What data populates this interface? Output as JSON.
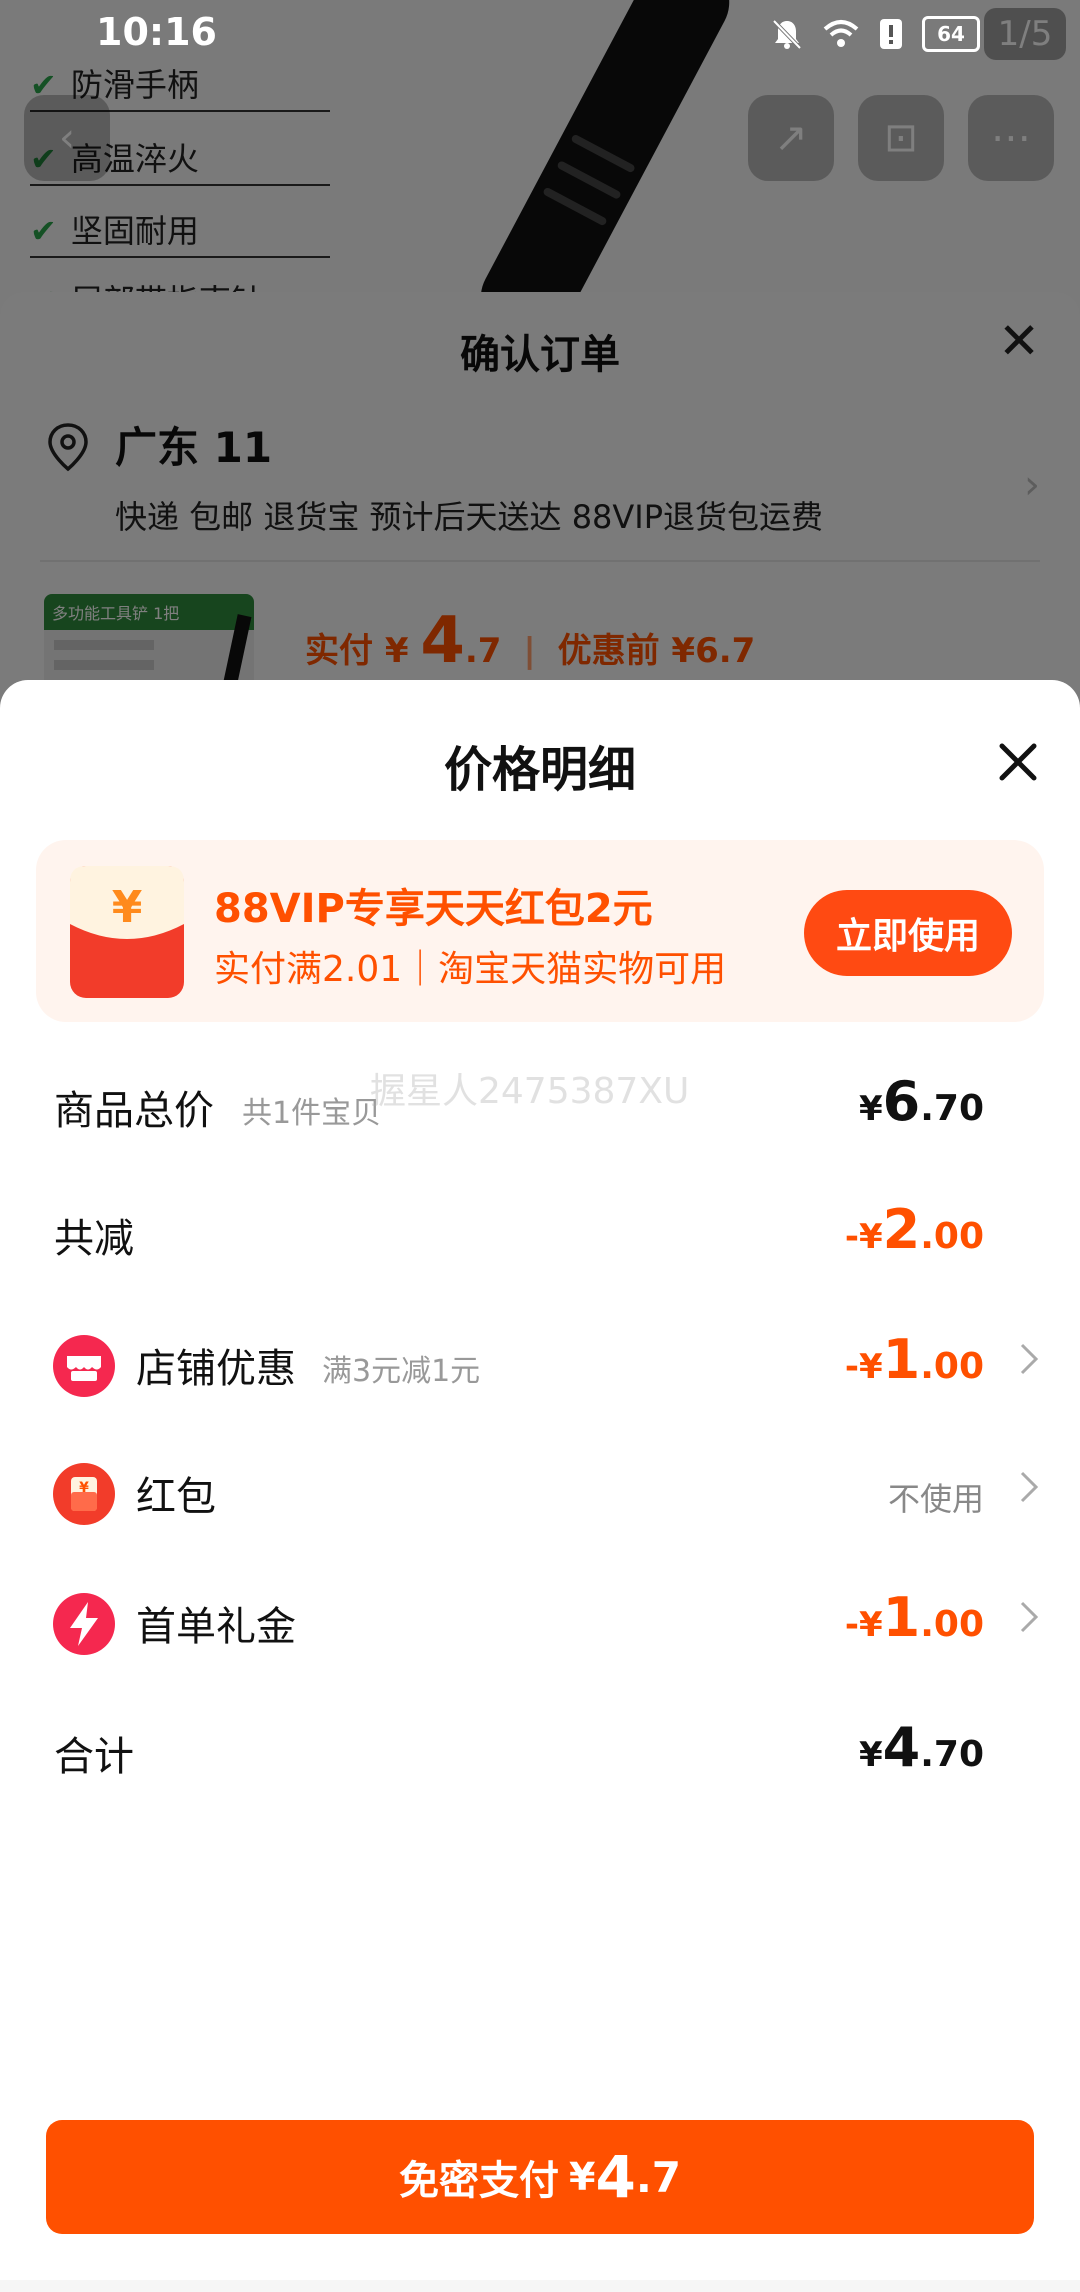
{
  "status_bar": {
    "time": "10:16",
    "battery": "64"
  },
  "background": {
    "features": [
      "防滑手柄",
      "高温淬火",
      "坚固耐用",
      "尾部带指南针"
    ],
    "page_indicator": "1/5",
    "confirm_order": {
      "title": "确认订单",
      "address_name": "广东 11",
      "delivery": "快递 包邮 退货宝 预计后天送达 88VIP退货包运费",
      "thumbnail_caption": "多功能工具铲",
      "thumbnail_badge": "1把",
      "paid_label": "实付",
      "paid_yen": "¥",
      "paid_int": "4",
      "paid_dec": ".7",
      "before_discount": "优惠前 ¥6.7"
    }
  },
  "price_detail": {
    "title": "价格明细",
    "promo": {
      "title": "88VIP专享天天红包2元",
      "subtitle": "实付满2.01｜淘宝天猫实物可用",
      "button": "立即使用"
    },
    "rows": [
      {
        "label": "商品总价",
        "note": "共1件宝贝",
        "sign": "¥",
        "int": "6",
        "dec": ".70"
      },
      {
        "label": "共减",
        "sign": "-¥",
        "int": "2",
        "dec": ".00"
      },
      {
        "label": "店铺优惠",
        "note": "满3元减1元",
        "sign": "-¥",
        "int": "1",
        "dec": ".00",
        "icon": "shop-icon"
      },
      {
        "label": "红包",
        "value_text": "不使用",
        "icon": "red-envelope-icon"
      },
      {
        "label": "首单礼金",
        "sign": "-¥",
        "int": "1",
        "dec": ".00",
        "icon": "lightning-icon"
      },
      {
        "label": "合计",
        "sign": "¥",
        "int": "4",
        "dec": ".70"
      }
    ],
    "watermark": "握星人2475387XU",
    "pay_button": {
      "label": "免密支付",
      "yen": "¥",
      "int": "4",
      "dec": ".7"
    }
  },
  "colors": {
    "accent": "#ff5000",
    "promo_bg": "#fff4ee"
  }
}
